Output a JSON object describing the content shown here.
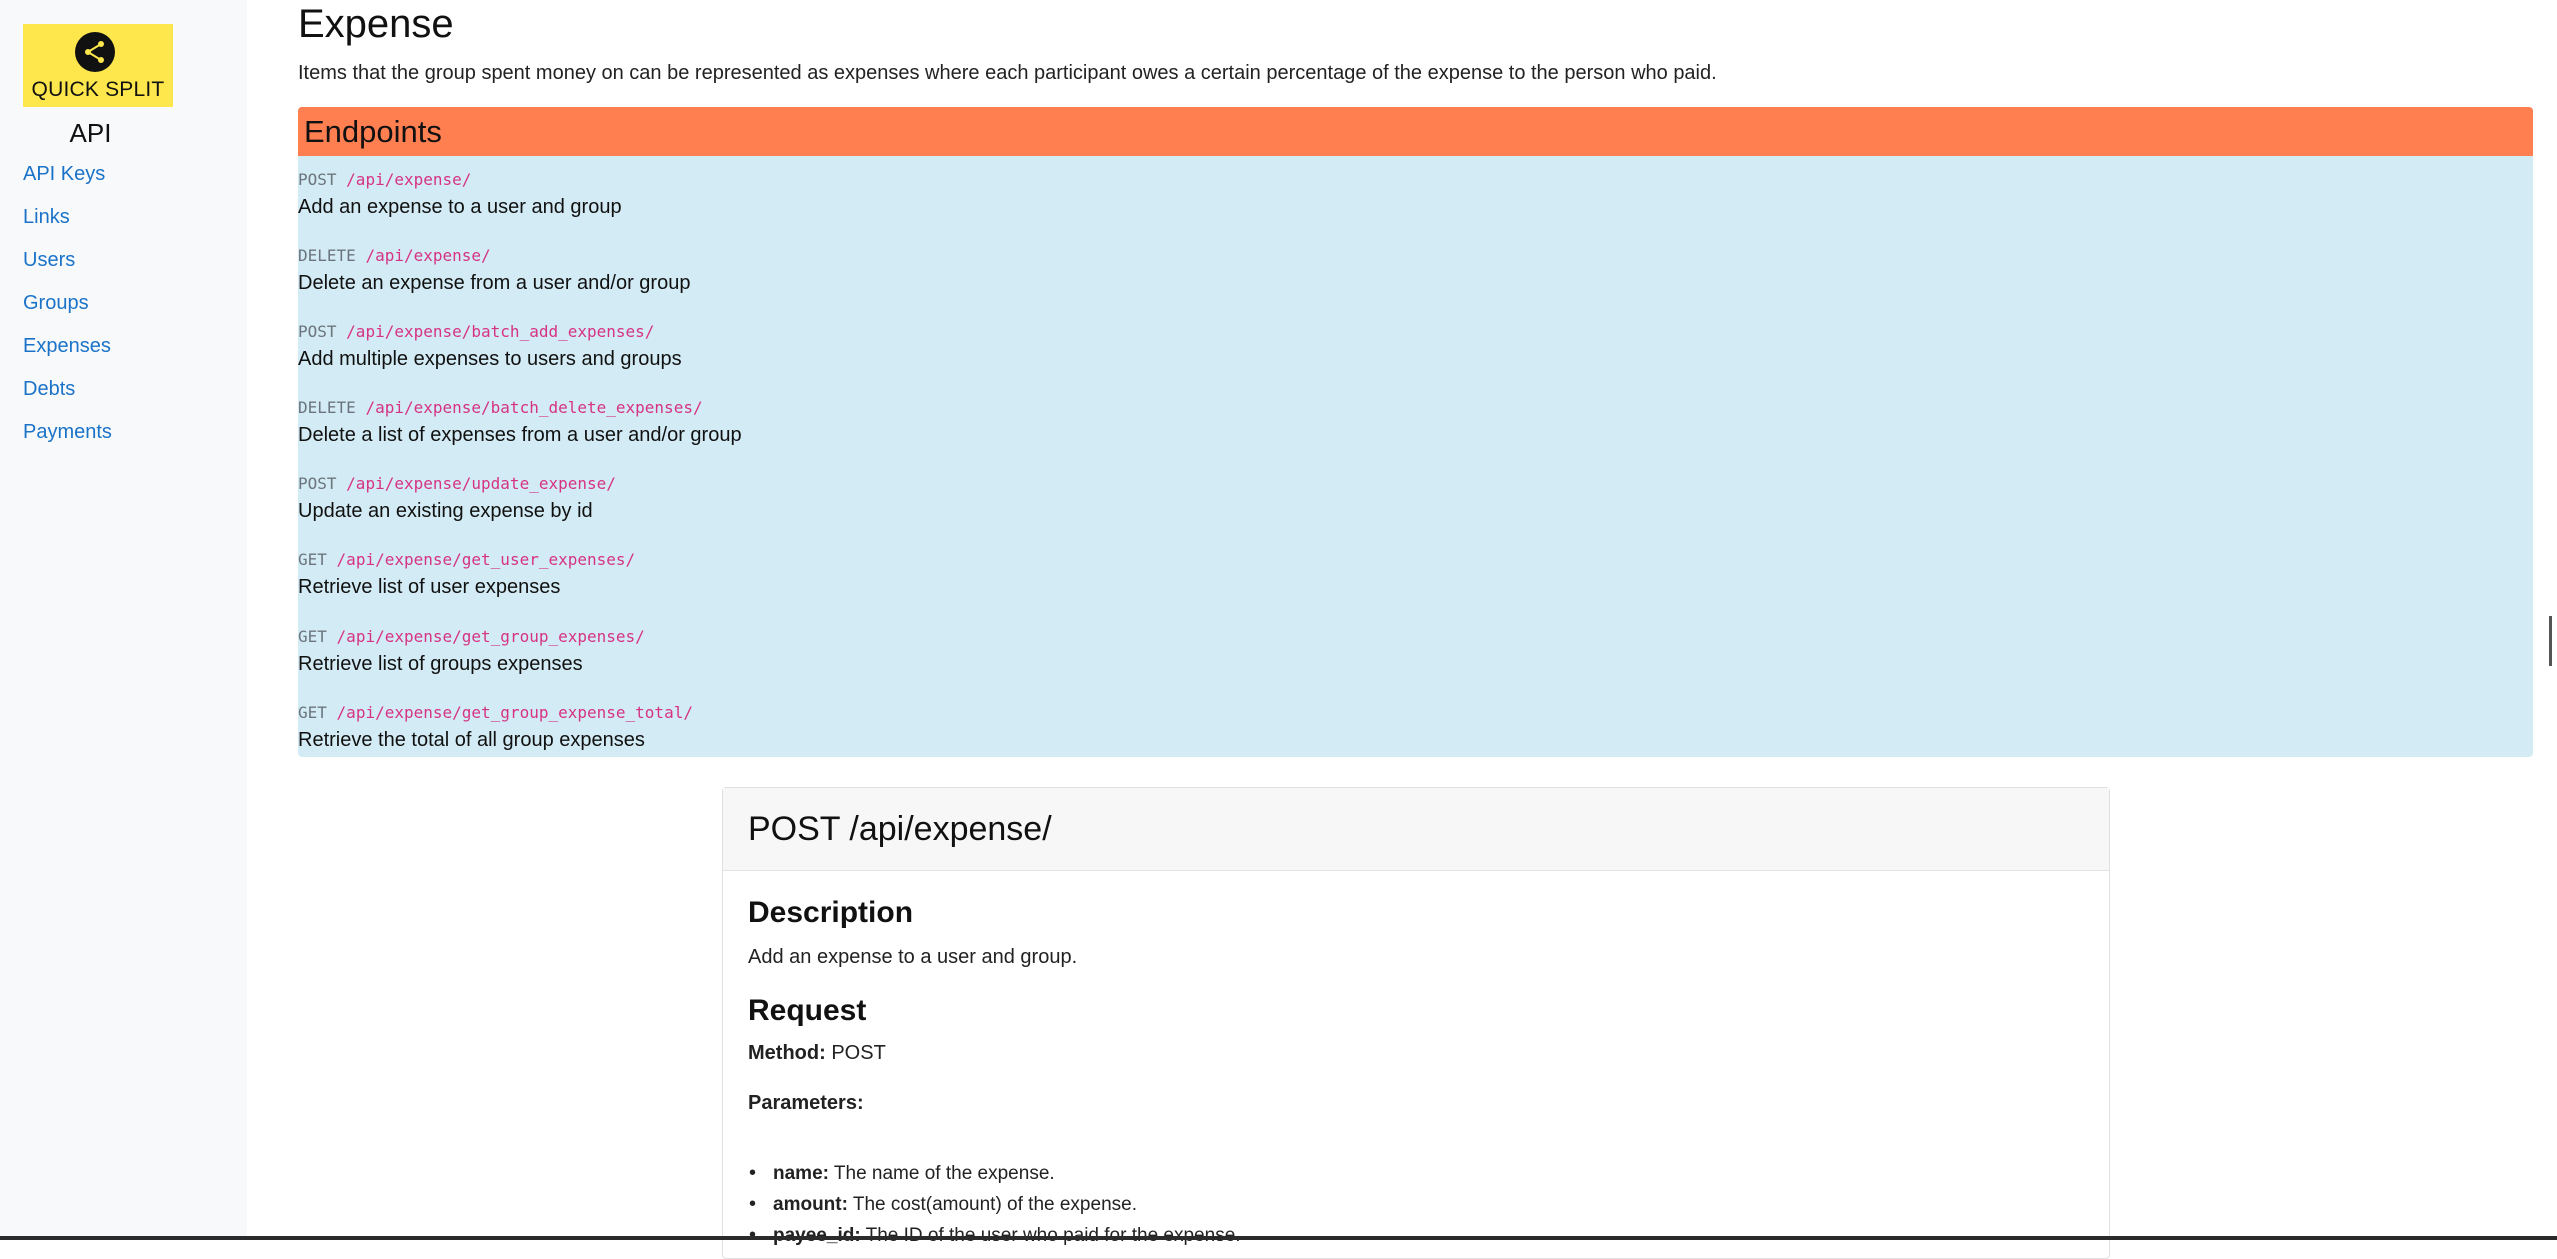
{
  "sidebar": {
    "logo_text": "QUICK SPLIT",
    "title": "API",
    "items": [
      {
        "label": "API Keys"
      },
      {
        "label": "Links"
      },
      {
        "label": "Users"
      },
      {
        "label": "Groups"
      },
      {
        "label": "Expenses"
      },
      {
        "label": "Debts"
      },
      {
        "label": "Payments"
      }
    ]
  },
  "main": {
    "title": "Expense",
    "intro": "Items that the group spent money on can be represented as expenses where each participant owes a certain percentage of the expense to the person who paid.",
    "endpoints_title": "Endpoints",
    "endpoints": [
      {
        "method": "POST",
        "path": "/api/expense/",
        "description": "Add an expense to a user and group"
      },
      {
        "method": "DELETE",
        "path": "/api/expense/",
        "description": "Delete an expense from a user and/or group"
      },
      {
        "method": "POST",
        "path": "/api/expense/batch_add_expenses/",
        "description": "Add multiple expenses to users and groups"
      },
      {
        "method": "DELETE",
        "path": "/api/expense/batch_delete_expenses/",
        "description": "Delete a list of expenses from a user and/or group"
      },
      {
        "method": "POST",
        "path": "/api/expense/update_expense/",
        "description": "Update an existing expense by id"
      },
      {
        "method": "GET",
        "path": "/api/expense/get_user_expenses/",
        "description": "Retrieve list of user expenses"
      },
      {
        "method": "GET",
        "path": "/api/expense/get_group_expenses/",
        "description": "Retrieve list of groups expenses"
      },
      {
        "method": "GET",
        "path": "/api/expense/get_group_expense_total/",
        "description": "Retrieve the total of all group expenses"
      }
    ],
    "card": {
      "title": "POST /api/expense/",
      "description_heading": "Description",
      "description": "Add an expense to a user and group.",
      "request_heading": "Request",
      "method_label": "Method:",
      "method_value": "POST",
      "parameters_label": "Parameters:",
      "parameters": [
        {
          "name": "name:",
          "text": "The name of the expense."
        },
        {
          "name": "amount:",
          "text": "The cost(amount) of the expense."
        },
        {
          "name": "payee_id:",
          "text": "The ID of the user who paid for the expense."
        }
      ]
    }
  },
  "colors": {
    "endpoints_header": "#ff7f50",
    "endpoints_bg": "#d3ebf4",
    "logo_bg": "#fde74c",
    "link": "#1a73c8",
    "path": "#d63384"
  }
}
